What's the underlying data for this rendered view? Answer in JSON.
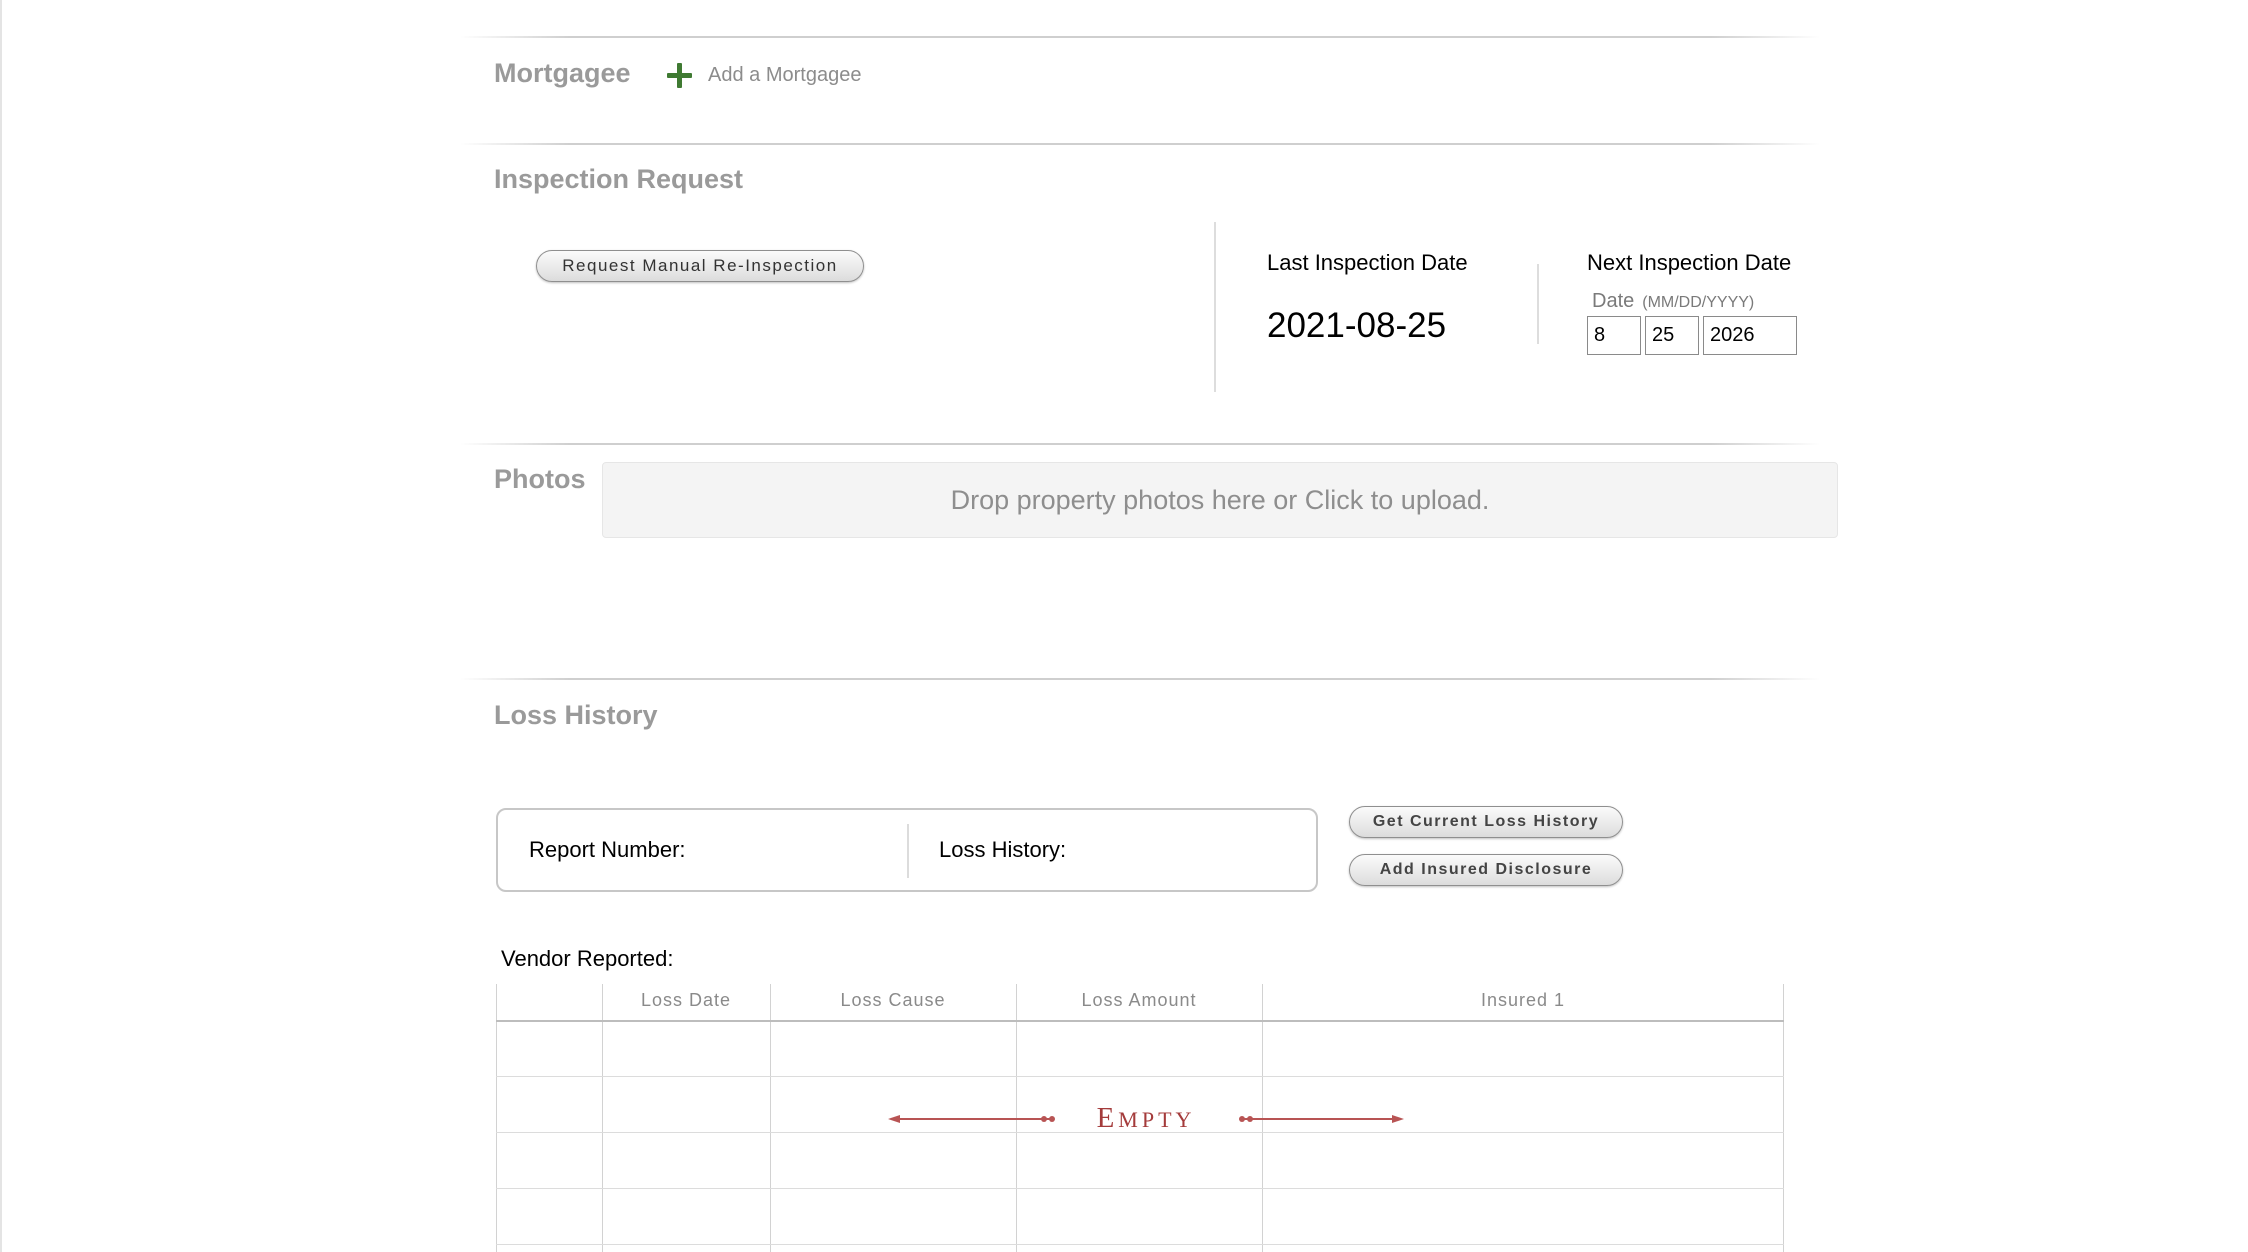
{
  "mortgagee": {
    "title": "Mortgagee",
    "add_label": "Add a Mortgagee"
  },
  "inspection": {
    "title": "Inspection Request",
    "request_button": "Request Manual Re-Inspection",
    "last_label": "Last Inspection Date",
    "last_value": "2021-08-25",
    "next_label": "Next Inspection Date",
    "date_caption": "Date",
    "date_format": "(MM/DD/YYYY)",
    "month": "8",
    "day": "25",
    "year": "2026"
  },
  "photos": {
    "title": "Photos",
    "dropzone_text": "Drop property photos here or Click to upload."
  },
  "loss_history": {
    "title": "Loss History",
    "report_number_label": "Report Number:",
    "loss_history_label": "Loss History:",
    "get_current_button": "Get Current Loss History",
    "add_disclosure_button": "Add Insured Disclosure",
    "vendor_label": "Vendor Reported:",
    "columns": [
      "",
      "Loss Date",
      "Loss Cause",
      "Loss Amount",
      "Insured 1"
    ],
    "empty_first": "E",
    "empty_rest": "MPTY"
  },
  "colors": {
    "section_title": "#9a9a9a",
    "add_icon": "#3f7a32",
    "empty_stamp": "#a43b3b"
  }
}
